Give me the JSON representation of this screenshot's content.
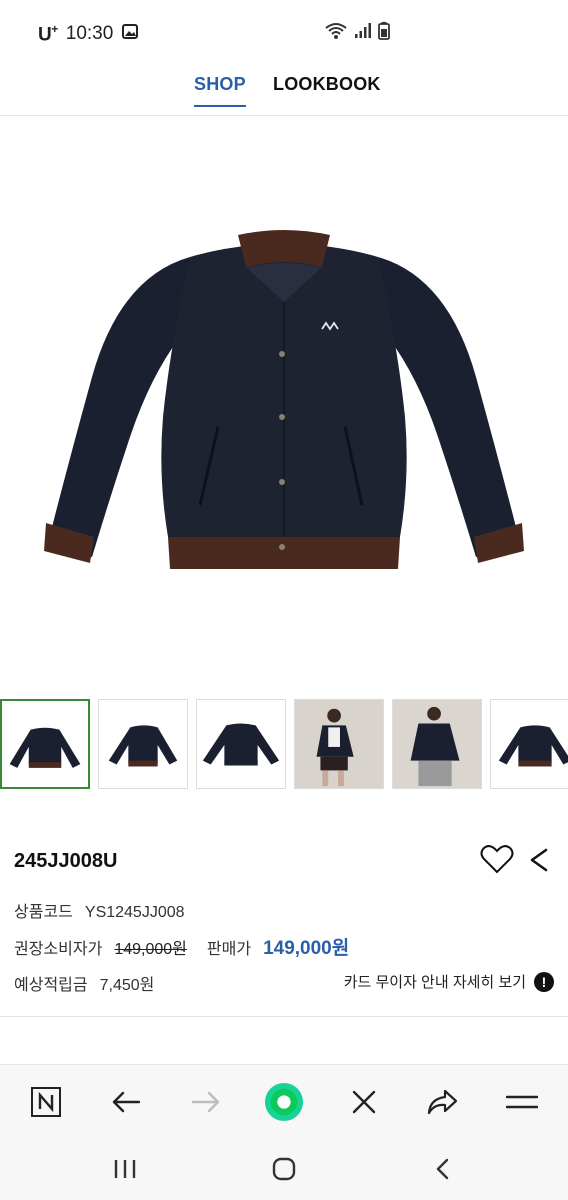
{
  "status_bar": {
    "carrier": "U",
    "carrier_sup": "+",
    "time": "10:30"
  },
  "tabs": [
    {
      "label": "SHOP",
      "active": true
    },
    {
      "label": "LOOKBOOK",
      "active": false
    }
  ],
  "colors": {
    "accent": "#2a5ea8",
    "thumb_active_border": "#3a8a3a",
    "jacket_body": "#1b2030",
    "jacket_rib": "#4a2a1f",
    "loader_green": "#17d39a"
  },
  "gallery": {
    "thumbnail_count": 6,
    "active_index": 0
  },
  "product": {
    "name": "245JJ008U",
    "code_label": "상품코드",
    "code_value": "YS1245JJ008",
    "msrp_label": "권장소비자가",
    "msrp_value": "149,000원",
    "sale_label": "판매가",
    "sale_value": "149,000원",
    "points_label": "예상적립금",
    "points_value": "7,450원",
    "card_info_label": "카드 무이자 안내 자세히 보기",
    "card_info_icon": "!"
  },
  "icons": {
    "wishlist": "heart-icon",
    "share": "share-icon",
    "naver": "naver-n-icon",
    "back": "arrow-left-icon",
    "forward": "arrow-right-icon",
    "home": "green-circle-icon",
    "close": "close-icon",
    "share_out": "share-arrow-icon",
    "menu": "menu-icon"
  }
}
